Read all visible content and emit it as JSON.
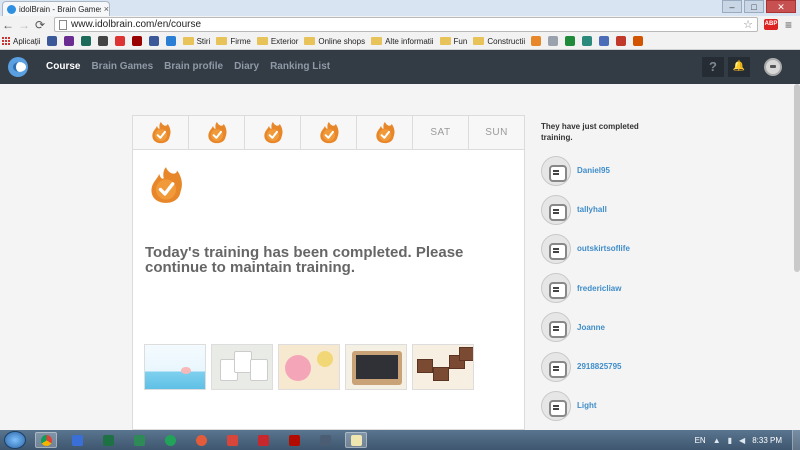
{
  "browser": {
    "tab_title": "idolBrain - Brain Games &",
    "tab_close": "×",
    "url": "www.idolbrain.com/en/course",
    "window_controls": {
      "minimize": "–",
      "maximize": "□",
      "close": "✕"
    },
    "nav_glyphs": {
      "back": "←",
      "forward": "→",
      "reload": "⟳",
      "star": "☆",
      "menu": "≡"
    },
    "extension_label": "ABP",
    "bookmarks": [
      {
        "label": "Aplicații",
        "icon": "apps-icon"
      },
      {
        "label": "Stiri",
        "icon": "folder-icon"
      },
      {
        "label": "Firme",
        "icon": "folder-icon"
      },
      {
        "label": "Exterior",
        "icon": "folder-icon"
      },
      {
        "label": "Online shops",
        "icon": "folder-icon"
      },
      {
        "label": "Alte informatii",
        "icon": "folder-icon"
      },
      {
        "label": "Fun",
        "icon": "folder-icon"
      },
      {
        "label": "Constructii",
        "icon": "folder-icon"
      }
    ]
  },
  "site": {
    "nav": [
      {
        "label": "Course",
        "active": true
      },
      {
        "label": "Brain Games",
        "active": false
      },
      {
        "label": "Brain profile",
        "active": false
      },
      {
        "label": "Diary",
        "active": false
      },
      {
        "label": "Ranking List",
        "active": false
      }
    ],
    "help_glyph": "?",
    "bell_glyph": "🔔"
  },
  "week": {
    "days": [
      {
        "label": "",
        "completed": true
      },
      {
        "label": "",
        "completed": true
      },
      {
        "label": "",
        "completed": true
      },
      {
        "label": "",
        "completed": true
      },
      {
        "label": "",
        "completed": true
      },
      {
        "label": "SAT",
        "completed": false
      },
      {
        "label": "SUN",
        "completed": false
      }
    ]
  },
  "main": {
    "message": "Today's training has been completed. Please continue to maintain training.",
    "games": [
      "game-1",
      "game-2",
      "game-3",
      "game-4",
      "game-5"
    ]
  },
  "sidebar": {
    "title": "They have just completed training.",
    "users": [
      "Daniel95",
      "tallyhall",
      "outskirtsoflife",
      "fredericliaw",
      "Joanne",
      "2918825795",
      "Light"
    ]
  },
  "taskbar": {
    "language": "EN",
    "time": "8:33 PM"
  },
  "colors": {
    "flame": "#e8872a",
    "header": "#333b45",
    "link": "#3f8dca"
  }
}
